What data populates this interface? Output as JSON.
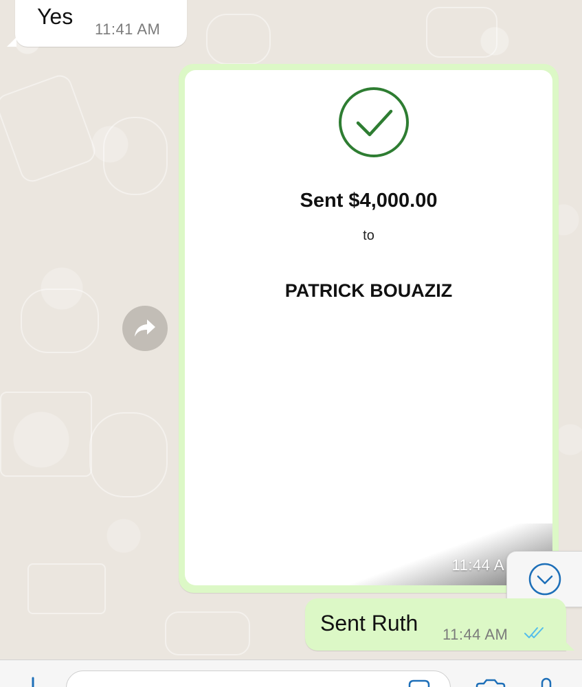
{
  "messages": {
    "incoming": {
      "text": "Yes",
      "time": "11:41 AM"
    },
    "payment_image": {
      "amount_text": "Sent $4,000.00",
      "to_label": "to",
      "recipient": "PATRICK BOUAZIZ",
      "time": "11:44 A",
      "status_icon": "check-circle-icon",
      "status_color": "#2e7d32"
    },
    "outgoing": {
      "text": "Sent Ruth",
      "time": "11:44 AM",
      "read_status": "read",
      "read_color": "#53bdeb"
    }
  },
  "controls": {
    "forward_icon": "forward-icon",
    "scroll_icon": "chevron-down-icon",
    "accent": "#1d6fb8"
  },
  "input_bar": {
    "placeholder": "",
    "icons": [
      "plus-icon",
      "sticker-icon",
      "camera-icon",
      "microphone-icon"
    ]
  },
  "colors": {
    "outgoing_bubble": "#dcf8c6",
    "incoming_bubble": "#ffffff",
    "wallpaper": "#ebe6df"
  }
}
